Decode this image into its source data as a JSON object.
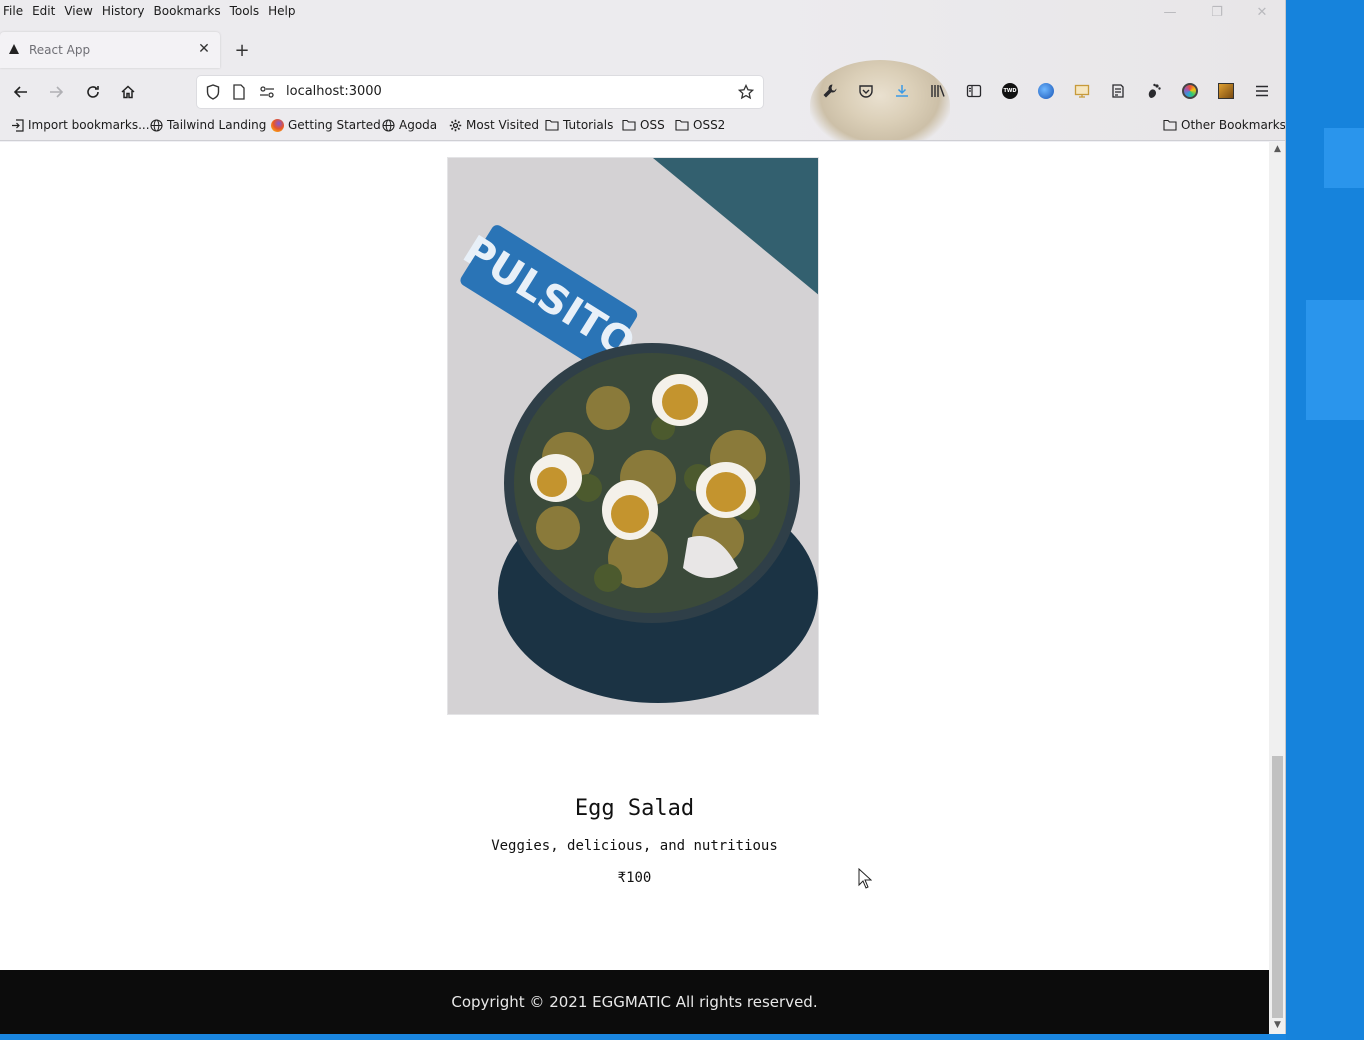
{
  "menubar": {
    "items": [
      "File",
      "Edit",
      "View",
      "History",
      "Bookmarks",
      "Tools",
      "Help"
    ]
  },
  "window_controls": {
    "minimize": "—",
    "restore": "❐",
    "close": "✕"
  },
  "tab": {
    "title": "React App",
    "close": "✕",
    "new_tab": "+"
  },
  "navigation": {
    "url": "localhost:3000"
  },
  "bookmarks": [
    {
      "label": "Import bookmarks...",
      "icon": "import-icon"
    },
    {
      "label": "Tailwind Landing",
      "icon": "globe-icon"
    },
    {
      "label": "Getting Started",
      "icon": "firefox-icon"
    },
    {
      "label": "Agoda",
      "icon": "globe-icon"
    },
    {
      "label": "Most Visited",
      "icon": "gear-icon"
    },
    {
      "label": "Tutorials",
      "icon": "folder-icon"
    },
    {
      "label": "OSS",
      "icon": "folder-icon"
    },
    {
      "label": "OSS2",
      "icon": "folder-icon"
    }
  ],
  "other_bookmarks": "Other Bookmarks",
  "toolbar_icons": {
    "twd": "TWD"
  },
  "product": {
    "image_text": "PULSITO",
    "name": "Egg Salad",
    "description": "Veggies, delicious, and nutritious",
    "price": "₹100"
  },
  "footer": {
    "copyright": "Copyright © 2021 EGGMATIC All rights reserved."
  },
  "colors": {
    "footer_bg": "#0c0c0c",
    "desktop_bg": "#1683dc",
    "image_bg": "#d4d2d4",
    "packet_blue": "#2a74b6",
    "teal_corner": "#33606f"
  }
}
